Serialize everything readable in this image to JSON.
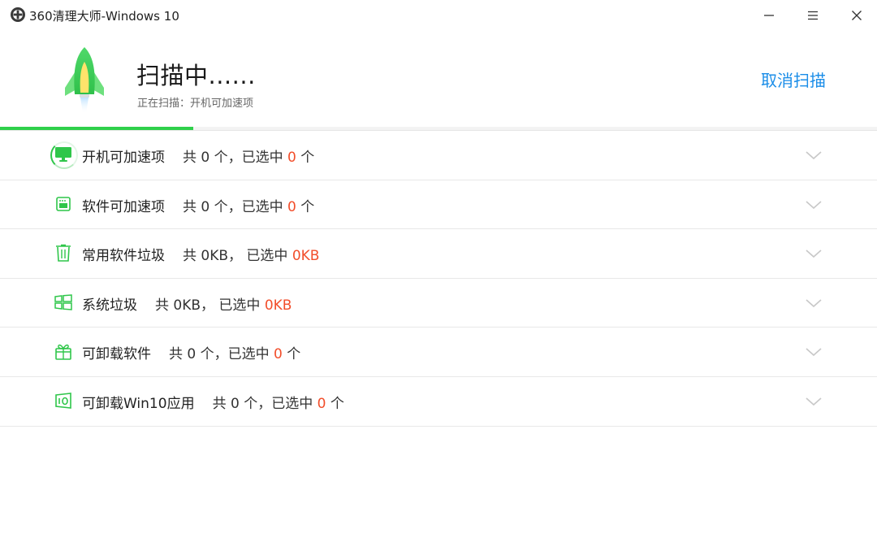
{
  "window": {
    "title": "360清理大师-Windows 10"
  },
  "header": {
    "status_title": "扫描中......",
    "status_sub": "正在扫描：开机可加速项",
    "cancel_label": "取消扫描",
    "progress_percent": 22
  },
  "items": [
    {
      "name": "开机可加速项",
      "prefix": "共 0 个，已选中 ",
      "selected": "0",
      "suffix": " 个",
      "icon": "monitor-icon"
    },
    {
      "name": "软件可加速项",
      "prefix": "共 0 个，已选中 ",
      "selected": "0",
      "suffix": " 个",
      "icon": "software-chip-icon"
    },
    {
      "name": "常用软件垃圾",
      "prefix": "共 0KB， 已选中 ",
      "selected": "0KB",
      "suffix": "",
      "icon": "trash-icon"
    },
    {
      "name": "系统垃圾",
      "prefix": "共 0KB， 已选中 ",
      "selected": "0KB",
      "suffix": "",
      "icon": "windows-icon"
    },
    {
      "name": "可卸载软件",
      "prefix": "共 0 个，已选中 ",
      "selected": "0",
      "suffix": " 个",
      "icon": "gift-box-icon"
    },
    {
      "name": "可卸载Win10应用",
      "prefix": "共 0 个，已选中 ",
      "selected": "0",
      "suffix": " 个",
      "icon": "win10-app-icon"
    }
  ],
  "colors": {
    "accent_green": "#2fd04a",
    "link_blue": "#1a8de8",
    "highlight_red": "#f24e2b"
  }
}
